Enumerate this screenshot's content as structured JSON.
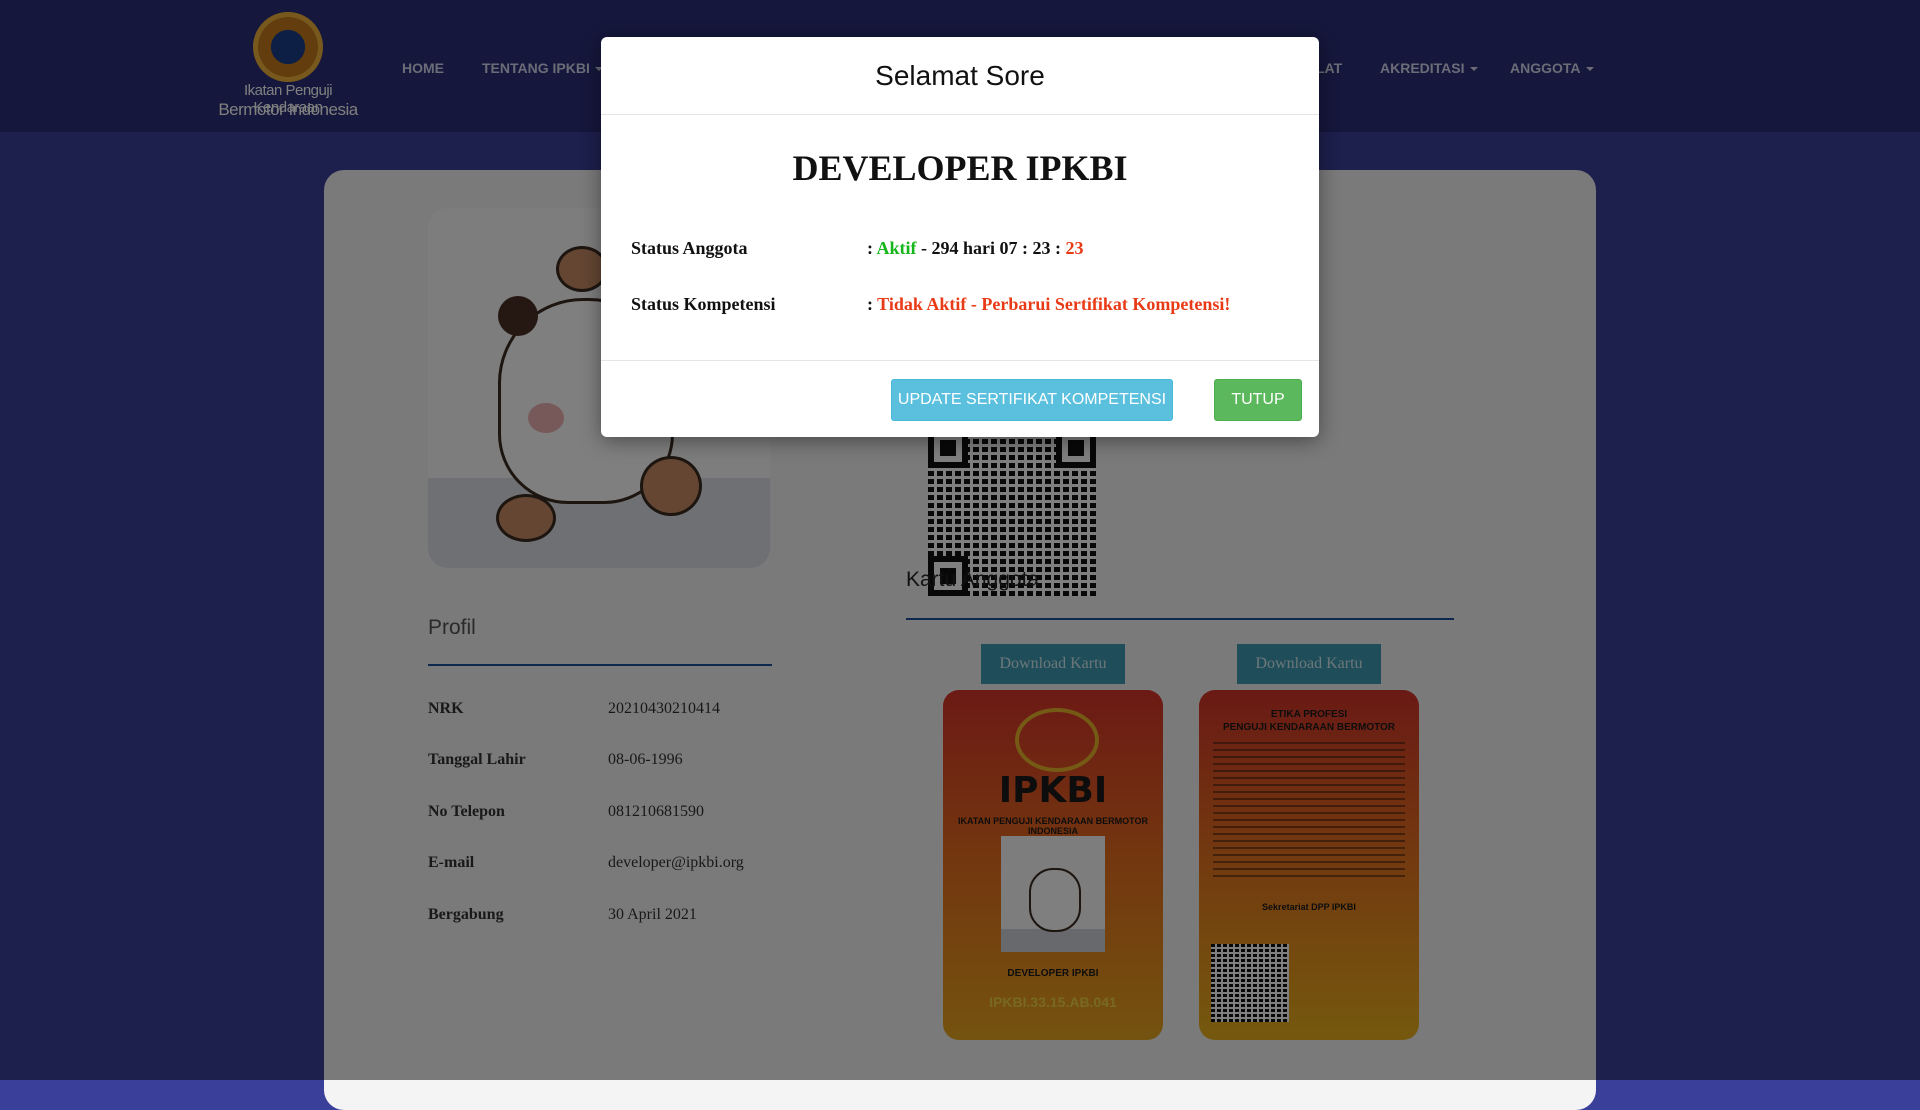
{
  "nav": {
    "logo_line1": "Ikatan Penguji Kendaraan",
    "logo_line2": "Bermotor Indonesia",
    "items": [
      {
        "label": "HOME"
      },
      {
        "label": "TENTANG IPKBI"
      },
      {
        "label": "LAT"
      },
      {
        "label": "AKREDITASI"
      },
      {
        "label": "ANGGOTA"
      }
    ]
  },
  "profile": {
    "title": "Profil",
    "rows": [
      {
        "label": "NRK",
        "value": "20210430210414"
      },
      {
        "label": "Tanggal Lahir",
        "value": "08-06-1996"
      },
      {
        "label": "No Telepon",
        "value": "081210681590"
      },
      {
        "label": "E-mail",
        "value": "developer@ipkbi.org"
      },
      {
        "label": "Bergabung",
        "value": "30 April 2021"
      }
    ]
  },
  "kartu": {
    "title": "Kartu Anggota",
    "download_label": "Download Kartu",
    "front": {
      "brand": "IPKBI",
      "subtitle": "IKATAN PENGUJI KENDARAAN BERMOTOR INDONESIA",
      "name": "DEVELOPER IPKBI",
      "nrk": "IPKBI.33.15.AB.041"
    },
    "back": {
      "title_line1": "ETIKA PROFESI",
      "title_line2": "PENGUJI KENDARAAN BERMOTOR",
      "sekretariat": "Sekretariat DPP IPKBI"
    }
  },
  "modal": {
    "greeting": "Selamat Sore",
    "heading": "DEVELOPER IPKBI",
    "status_anggota_label": "Status Anggota",
    "status_anggota_prefix": ": ",
    "status_anggota_active": "Aktif",
    "status_anggota_time": " - 294 hari 07 : 23 : ",
    "status_anggota_seconds": "23",
    "status_kompetensi_label": "Status Kompetensi",
    "status_kompetensi_prefix": ": ",
    "status_kompetensi_value": "Tidak Aktif - Perbarui Sertifikat Kompetensi!",
    "update_button": "UPDATE SERTIFIKAT KOMPETENSI",
    "close_button": "TUTUP"
  },
  "colors": {
    "navbar": "#2a2f78",
    "background": "#3a3f9a",
    "active_green": "#16b61a",
    "warning_red": "#e93a16",
    "info_button": "#5bc0de",
    "success_button": "#5cb85c"
  }
}
